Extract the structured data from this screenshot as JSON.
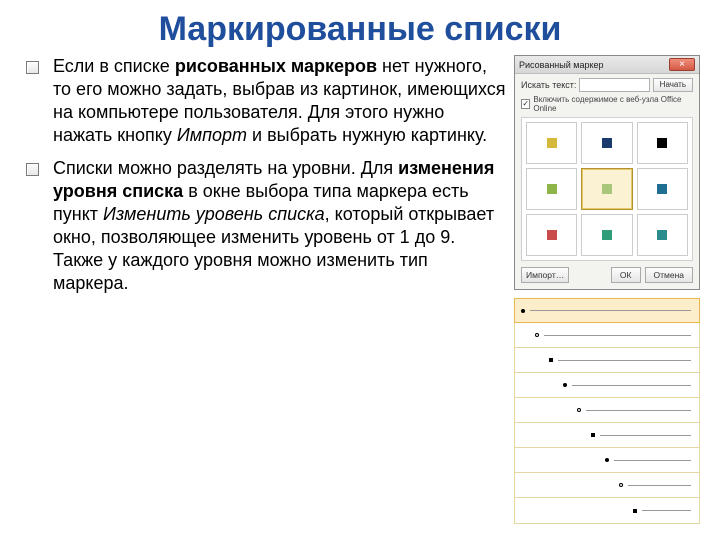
{
  "title": "Маркированные списки",
  "bullets": {
    "item1": {
      "pre": "Если в списке ",
      "bold1": "рисованных маркеров",
      "mid1": " нет нужного, то его можно задать, выбрав из картинок, имеющихся на компьютере пользователя. Для этого нужно нажать кнопку ",
      "italic1": "Импорт",
      "tail1": " и выбрать нужную картинку."
    },
    "item2": {
      "pre": "Списки можно разделять на уровни. Для ",
      "bold1": "изменения уровня списка",
      "mid1": " в окне выбора типа маркера есть пункт ",
      "italic1": "Изменить уровень списка",
      "tail1": ", который открывает окно, позволяющее изменить уровень от 1 до 9. Также у каждого уровня можно изменить тип маркера."
    }
  },
  "dialog": {
    "title": "Рисованный маркер",
    "search_label": "Искать текст:",
    "go_label": "Начать",
    "checkbox_label": "Включить содержимое с веб-узла Office Online",
    "import_label": "Импорт…",
    "ok_label": "ОК",
    "cancel_label": "Отмена",
    "markers": [
      {
        "color": "#d6b93a"
      },
      {
        "color": "#1b3a6e"
      },
      {
        "color": "#000000"
      },
      {
        "color": "#8fb54a"
      },
      {
        "color": "#a8c77a",
        "selected": true
      },
      {
        "color": "#1f6f93"
      },
      {
        "color": "#c94b4b"
      },
      {
        "color": "#2f9c7a"
      },
      {
        "color": "#2a8c8c"
      }
    ]
  },
  "levels": {
    "indents": [
      6,
      20,
      34,
      48,
      62,
      76,
      90,
      104,
      118
    ],
    "shapes": [
      "dot",
      "hollow",
      "square",
      "dot",
      "hollow",
      "square",
      "dot",
      "hollow",
      "square"
    ]
  }
}
